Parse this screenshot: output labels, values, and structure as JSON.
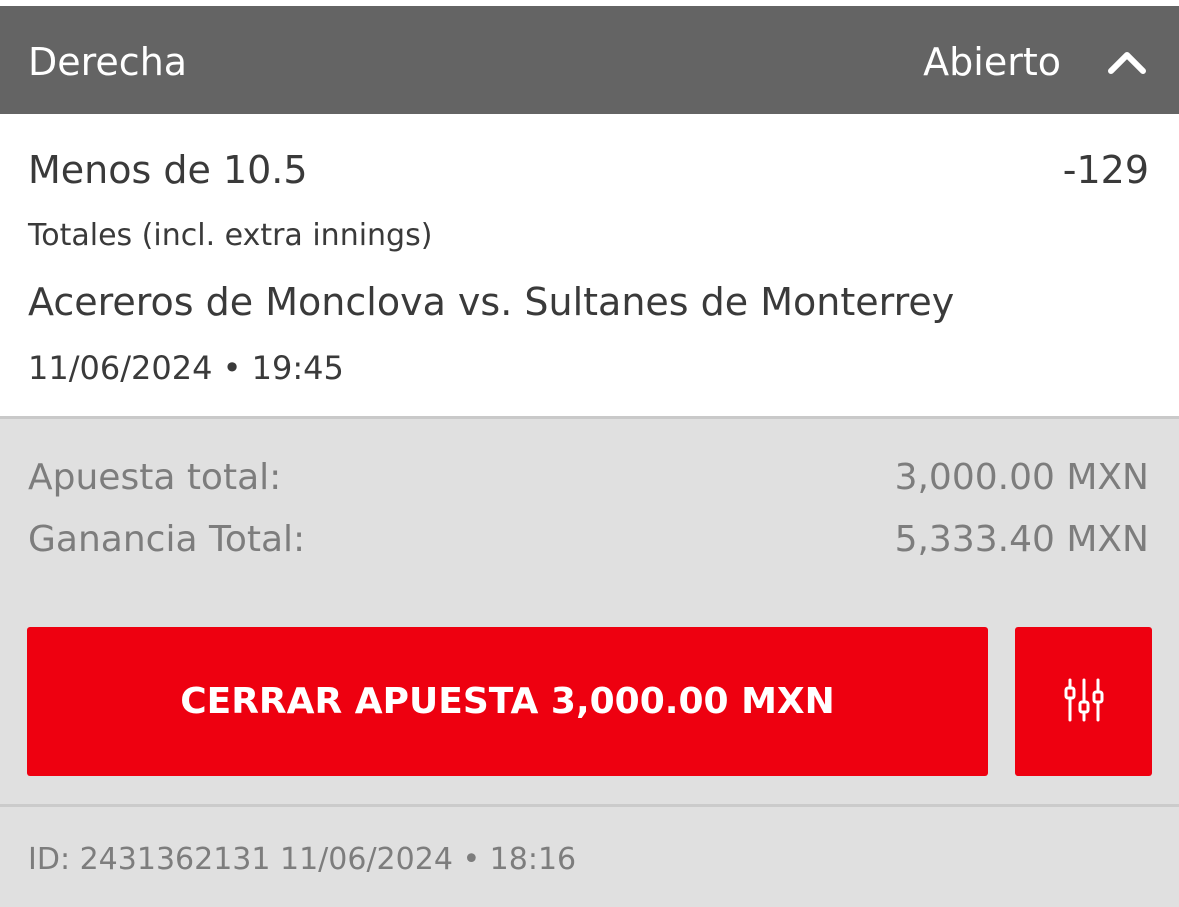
{
  "header": {
    "title": "Derecha",
    "status": "Abierto",
    "toggle_icon": "chevron-up-icon"
  },
  "bet": {
    "selection": "Menos de 10.5",
    "odds": "-129",
    "market": "Totales (incl. extra innings)",
    "match": "Acereros de Monclova vs. Sultanes de Monterrey",
    "event_datetime": "11/06/2024 • 19:45"
  },
  "summary": {
    "stake_label": "Apuesta total:",
    "stake_value": "3,000.00 MXN",
    "win_label": "Ganancia Total:",
    "win_value": "5,333.40 MXN"
  },
  "actions": {
    "cashout_label": "CERRAR APUESTA 3,000.00 MXN",
    "settings_icon": "sliders-icon"
  },
  "footer": {
    "id_text": "ID: 2431362131 11/06/2024 • 18:16"
  },
  "colors": {
    "header_bg": "#646464",
    "accent_red": "#ee0010",
    "panel_bg": "#e0e0e0",
    "card_bg": "#ffffff",
    "muted_text": "#7d7d7d",
    "body_text": "#3a3a3a"
  }
}
